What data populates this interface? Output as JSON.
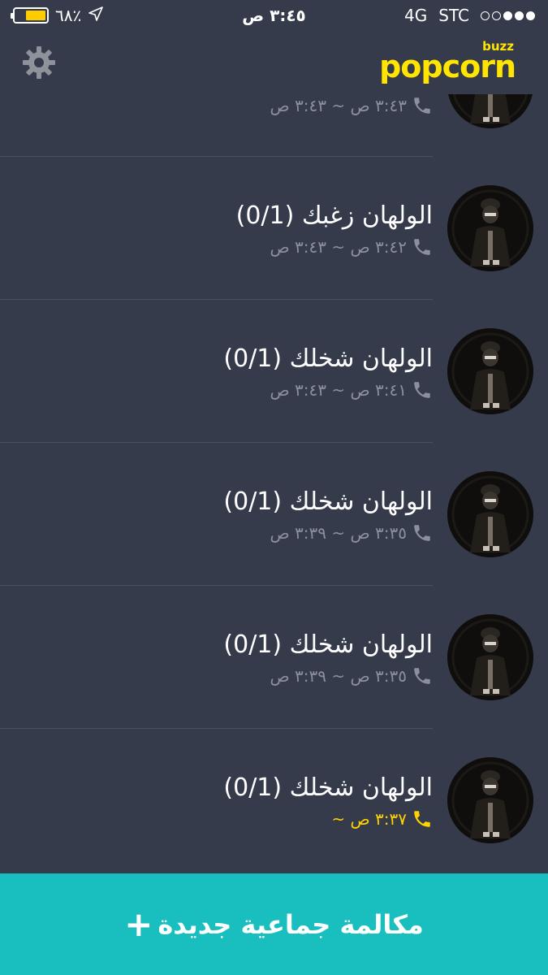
{
  "status_bar": {
    "battery": "٦٨٪",
    "battery_level_percent": 68,
    "time": "٣:٤٥ ص",
    "network": "4G",
    "carrier": "STC",
    "signal_bars_filled": 3,
    "signal_bars_total": 5
  },
  "header": {
    "logo_text": "popcorn",
    "logo_subtext": "buzz",
    "settings_icon": "gear-icon"
  },
  "calls": [
    {
      "title": "",
      "subtitle": "٣:٤٣ ص ~ ٣:٤٣ ص",
      "active": false
    },
    {
      "title": "الولهان زغبك (0/1)",
      "subtitle": "٣:٤٢ ص ~ ٣:٤٣ ص",
      "active": false
    },
    {
      "title": "الولهان شخلك (0/1)",
      "subtitle": "٣:٤١ ص ~ ٣:٤٣ ص",
      "active": false
    },
    {
      "title": "الولهان شخلك (0/1)",
      "subtitle": "٣:٣٥ ص ~ ٣:٣٩ ص",
      "active": false
    },
    {
      "title": "الولهان شخلك (0/1)",
      "subtitle": "٣:٣٥ ص ~ ٣:٣٩ ص",
      "active": false
    },
    {
      "title": "الولهان شخلك (0/1)",
      "subtitle": "٣:٣٧ ص ~",
      "active": true
    }
  ],
  "colors": {
    "background": "#353b4a",
    "accent": "#ffe500",
    "button": "#19bfbe",
    "muted_text": "#8b909c"
  },
  "new_call_button": {
    "label": "مكالمة جماعية جديدة",
    "icon": "plus-icon"
  }
}
